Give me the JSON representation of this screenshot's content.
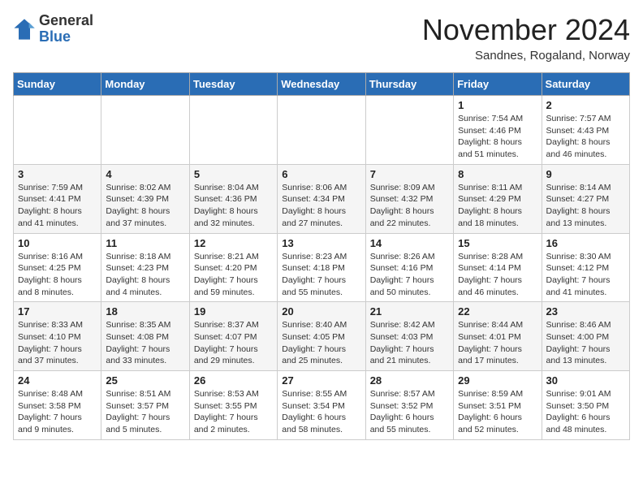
{
  "header": {
    "logo_general": "General",
    "logo_blue": "Blue",
    "month_title": "November 2024",
    "subtitle": "Sandnes, Rogaland, Norway"
  },
  "days_of_week": [
    "Sunday",
    "Monday",
    "Tuesday",
    "Wednesday",
    "Thursday",
    "Friday",
    "Saturday"
  ],
  "weeks": [
    [
      {
        "day": "",
        "info": ""
      },
      {
        "day": "",
        "info": ""
      },
      {
        "day": "",
        "info": ""
      },
      {
        "day": "",
        "info": ""
      },
      {
        "day": "",
        "info": ""
      },
      {
        "day": "1",
        "info": "Sunrise: 7:54 AM\nSunset: 4:46 PM\nDaylight: 8 hours and 51 minutes."
      },
      {
        "day": "2",
        "info": "Sunrise: 7:57 AM\nSunset: 4:43 PM\nDaylight: 8 hours and 46 minutes."
      }
    ],
    [
      {
        "day": "3",
        "info": "Sunrise: 7:59 AM\nSunset: 4:41 PM\nDaylight: 8 hours and 41 minutes."
      },
      {
        "day": "4",
        "info": "Sunrise: 8:02 AM\nSunset: 4:39 PM\nDaylight: 8 hours and 37 minutes."
      },
      {
        "day": "5",
        "info": "Sunrise: 8:04 AM\nSunset: 4:36 PM\nDaylight: 8 hours and 32 minutes."
      },
      {
        "day": "6",
        "info": "Sunrise: 8:06 AM\nSunset: 4:34 PM\nDaylight: 8 hours and 27 minutes."
      },
      {
        "day": "7",
        "info": "Sunrise: 8:09 AM\nSunset: 4:32 PM\nDaylight: 8 hours and 22 minutes."
      },
      {
        "day": "8",
        "info": "Sunrise: 8:11 AM\nSunset: 4:29 PM\nDaylight: 8 hours and 18 minutes."
      },
      {
        "day": "9",
        "info": "Sunrise: 8:14 AM\nSunset: 4:27 PM\nDaylight: 8 hours and 13 minutes."
      }
    ],
    [
      {
        "day": "10",
        "info": "Sunrise: 8:16 AM\nSunset: 4:25 PM\nDaylight: 8 hours and 8 minutes."
      },
      {
        "day": "11",
        "info": "Sunrise: 8:18 AM\nSunset: 4:23 PM\nDaylight: 8 hours and 4 minutes."
      },
      {
        "day": "12",
        "info": "Sunrise: 8:21 AM\nSunset: 4:20 PM\nDaylight: 7 hours and 59 minutes."
      },
      {
        "day": "13",
        "info": "Sunrise: 8:23 AM\nSunset: 4:18 PM\nDaylight: 7 hours and 55 minutes."
      },
      {
        "day": "14",
        "info": "Sunrise: 8:26 AM\nSunset: 4:16 PM\nDaylight: 7 hours and 50 minutes."
      },
      {
        "day": "15",
        "info": "Sunrise: 8:28 AM\nSunset: 4:14 PM\nDaylight: 7 hours and 46 minutes."
      },
      {
        "day": "16",
        "info": "Sunrise: 8:30 AM\nSunset: 4:12 PM\nDaylight: 7 hours and 41 minutes."
      }
    ],
    [
      {
        "day": "17",
        "info": "Sunrise: 8:33 AM\nSunset: 4:10 PM\nDaylight: 7 hours and 37 minutes."
      },
      {
        "day": "18",
        "info": "Sunrise: 8:35 AM\nSunset: 4:08 PM\nDaylight: 7 hours and 33 minutes."
      },
      {
        "day": "19",
        "info": "Sunrise: 8:37 AM\nSunset: 4:07 PM\nDaylight: 7 hours and 29 minutes."
      },
      {
        "day": "20",
        "info": "Sunrise: 8:40 AM\nSunset: 4:05 PM\nDaylight: 7 hours and 25 minutes."
      },
      {
        "day": "21",
        "info": "Sunrise: 8:42 AM\nSunset: 4:03 PM\nDaylight: 7 hours and 21 minutes."
      },
      {
        "day": "22",
        "info": "Sunrise: 8:44 AM\nSunset: 4:01 PM\nDaylight: 7 hours and 17 minutes."
      },
      {
        "day": "23",
        "info": "Sunrise: 8:46 AM\nSunset: 4:00 PM\nDaylight: 7 hours and 13 minutes."
      }
    ],
    [
      {
        "day": "24",
        "info": "Sunrise: 8:48 AM\nSunset: 3:58 PM\nDaylight: 7 hours and 9 minutes."
      },
      {
        "day": "25",
        "info": "Sunrise: 8:51 AM\nSunset: 3:57 PM\nDaylight: 7 hours and 5 minutes."
      },
      {
        "day": "26",
        "info": "Sunrise: 8:53 AM\nSunset: 3:55 PM\nDaylight: 7 hours and 2 minutes."
      },
      {
        "day": "27",
        "info": "Sunrise: 8:55 AM\nSunset: 3:54 PM\nDaylight: 6 hours and 58 minutes."
      },
      {
        "day": "28",
        "info": "Sunrise: 8:57 AM\nSunset: 3:52 PM\nDaylight: 6 hours and 55 minutes."
      },
      {
        "day": "29",
        "info": "Sunrise: 8:59 AM\nSunset: 3:51 PM\nDaylight: 6 hours and 52 minutes."
      },
      {
        "day": "30",
        "info": "Sunrise: 9:01 AM\nSunset: 3:50 PM\nDaylight: 6 hours and 48 minutes."
      }
    ]
  ]
}
